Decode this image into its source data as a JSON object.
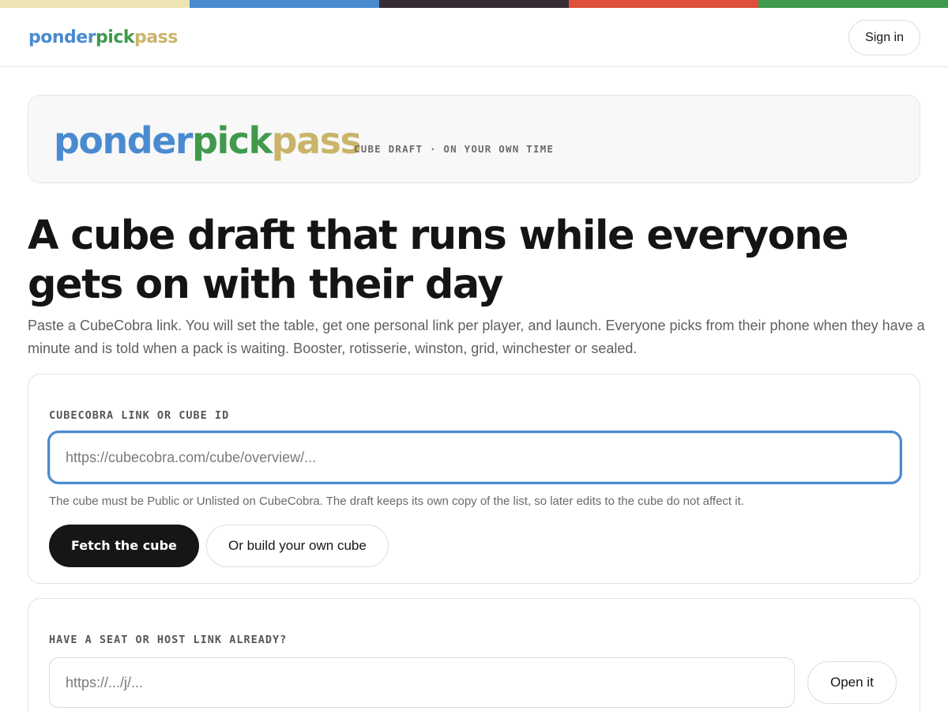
{
  "colors": {
    "bar": [
      "#ede4b3",
      "#4a8bd0",
      "#352d33",
      "#df4f3b",
      "#3f9a4c"
    ],
    "brand_ponder": "#4a8bd0",
    "brand_pick": "#3f9a4c",
    "brand_pass": "#c9b46a",
    "focus_ring": "#4a8bd0"
  },
  "nav": {
    "brand": {
      "part1": "ponder",
      "part2": "pick",
      "part3": "pass"
    },
    "signin_label": "Sign in"
  },
  "hero": {
    "brand": {
      "part1": "ponder",
      "part2": "pick",
      "part3": "pass"
    },
    "tagline": "CUBE DRAFT · ON YOUR OWN TIME"
  },
  "headline": "A cube draft that runs while everyone gets on with their day",
  "intro": "Paste a CubeCobra link. You will set the table, get one personal link per player, and launch. Everyone picks from their phone when they have a minute and is told when a pack is waiting. Booster, rotisserie, winston, grid, winchester or sealed.",
  "cube_form": {
    "label": "CUBECOBRA LINK OR CUBE ID",
    "placeholder": "https://cubecobra.com/cube/overview/...",
    "hint": "The cube must be Public or Unlisted on CubeCobra. The draft keeps its own copy of the list, so later edits to the cube do not affect it.",
    "fetch_label": "Fetch the cube",
    "build_label": "Or build your own cube"
  },
  "link_form": {
    "label": "HAVE A SEAT OR HOST LINK ALREADY?",
    "placeholder": "https://.../j/...",
    "open_label": "Open it"
  }
}
